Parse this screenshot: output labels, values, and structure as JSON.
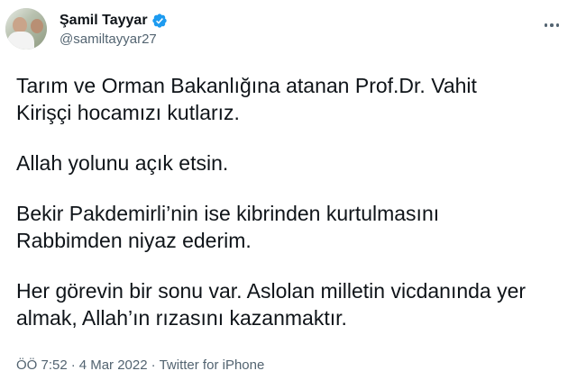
{
  "author": {
    "name": "Şamil Tayyar",
    "handle": "@samiltayyar27",
    "verified": true,
    "badge_color": "#1d9bf0"
  },
  "header": {
    "more_icon": "more-horizontal-icon"
  },
  "tweet": {
    "paragraphs": [
      {
        "lines": [
          "Tarım ve Orman Bakanlığına atanan Prof.Dr. Vahit",
          "Kirişçi hocamızı kutlarız."
        ]
      },
      {
        "lines": [
          "Allah yolunu açık etsin."
        ]
      },
      {
        "lines": [
          "Bekir Pakdemirli’nin ise kibrinden kurtulmasını",
          "Rabbimden niyaz ederim."
        ]
      },
      {
        "lines": [
          "Her görevin bir sonu var. Aslolan milletin vicdanında yer",
          "almak, Allah’ın rızasını kazanmaktır."
        ]
      }
    ]
  },
  "meta": {
    "time": "ÖÖ 7:52",
    "separator": "·",
    "date": "4 Mar 2022",
    "source": "Twitter for iPhone"
  },
  "colors": {
    "text": "#0f1419",
    "secondary": "#536471",
    "background": "#ffffff"
  }
}
